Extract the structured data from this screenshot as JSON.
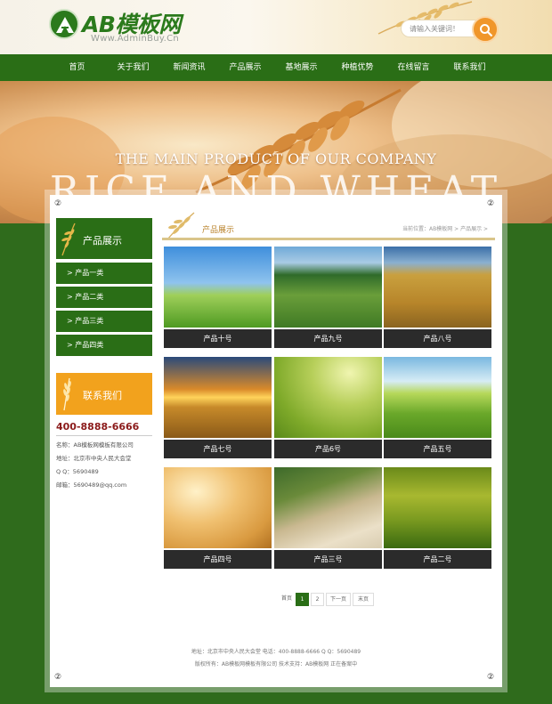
{
  "header": {
    "logo_text": "AB模板网",
    "logo_sub": "Www.AdminBuy.Cn",
    "search_placeholder": "请输入关键词！"
  },
  "nav": [
    "首页",
    "关于我们",
    "新闻资讯",
    "产品展示",
    "基地展示",
    "种植优势",
    "在线留言",
    "联系我们"
  ],
  "banner": {
    "title": "THE MAIN PRODUCT OF OUR COMPANY",
    "big_text": "RICE AND WHEAT"
  },
  "corner_mark": "②",
  "sidebar": {
    "title": "产品展示",
    "items": [
      "> 产品一类",
      "> 产品二类",
      "> 产品三类",
      "> 产品四类"
    ],
    "contact_title": "联系我们",
    "phone": "400-8888-6666",
    "info": [
      "名称：AB模板网模板有限公司",
      "地址：北京市中央人民大会堂",
      "Q Q：5690489",
      "邮箱：5690489@qq.com"
    ]
  },
  "main": {
    "title": "产品展示",
    "breadcrumb": "当前位置：AB模板网 > 产品展示 >",
    "products": [
      "产品十号",
      "产品九号",
      "产品八号",
      "产品七号",
      "产品6号",
      "产品五号",
      "产品四号",
      "产品三号",
      "产品二号"
    ]
  },
  "pager": {
    "first": "首页",
    "pages": [
      "1",
      "2"
    ],
    "next": "下一页",
    "last": "末页"
  },
  "footer": {
    "line1": "地址：北京市中央人民大会堂    电话：400-8888-6666    Q Q：5690489",
    "line2": "版权所有：AB模板网模板有限公司    技术支持：AB模板网    正在备案中"
  },
  "colors": {
    "green": "#2a6e16",
    "orange": "#f2a21d",
    "phone_red": "#8b1a1a"
  }
}
